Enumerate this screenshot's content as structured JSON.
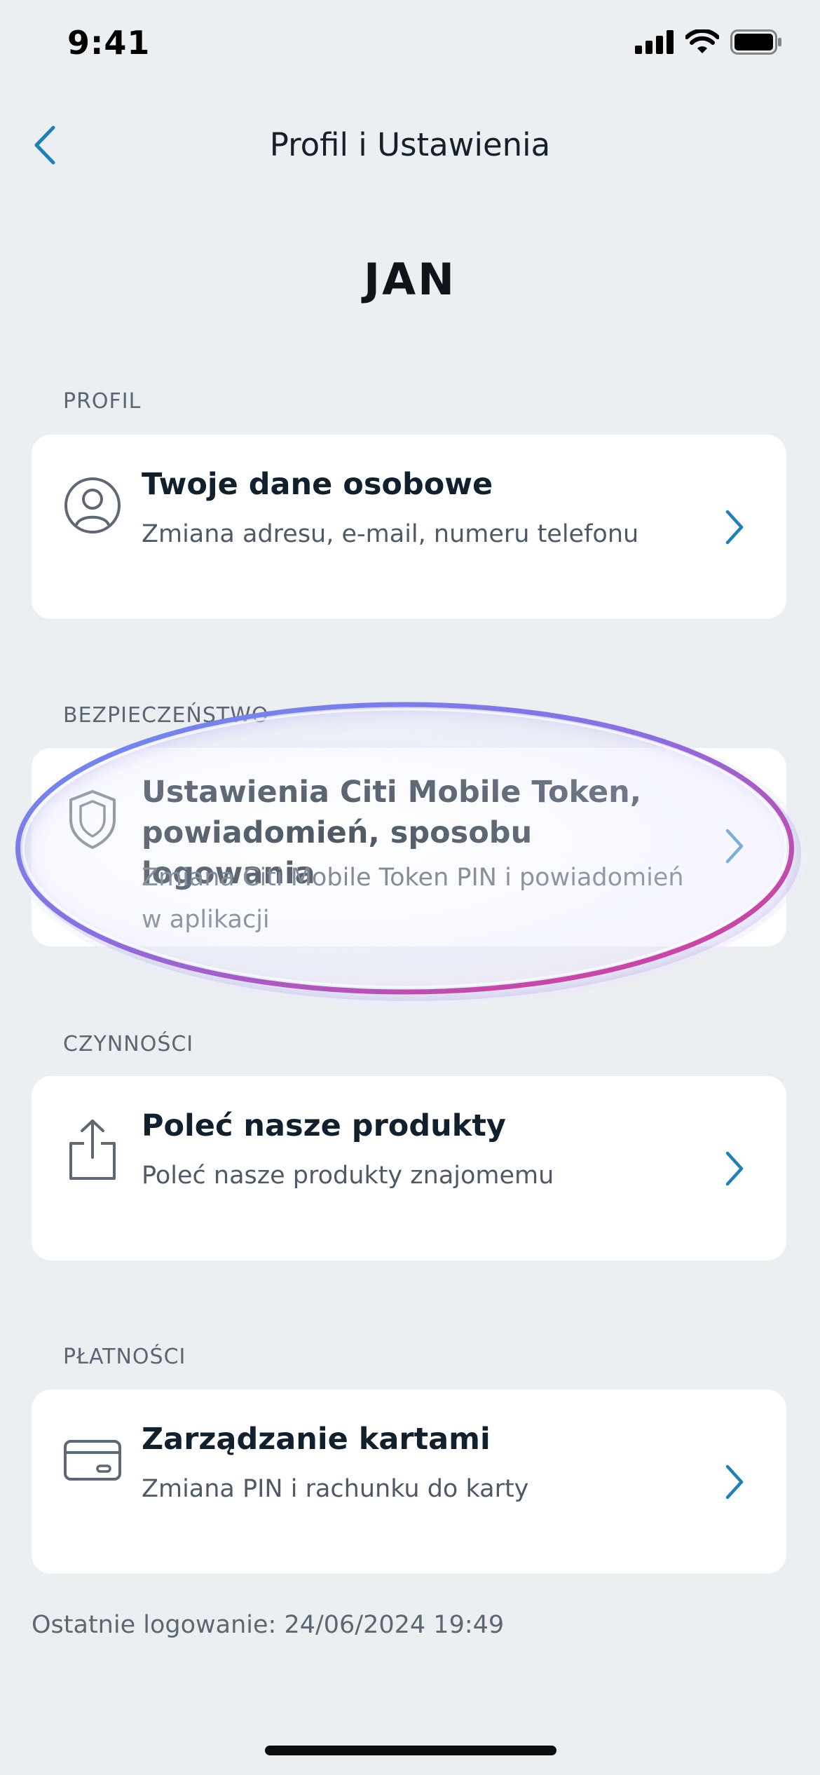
{
  "status_bar": {
    "time": "9:41"
  },
  "nav": {
    "title": "Profil i Ustawienia"
  },
  "user": {
    "name": "JAN"
  },
  "sections": {
    "profil": {
      "label": "PROFIL",
      "card": {
        "title": "Twoje dane osobowe",
        "subtitle": "Zmiana adresu, e-mail, numeru telefonu",
        "icon": "user-circle-icon"
      }
    },
    "bezpieczenstwo": {
      "label": "BEZPIECZEŃSTWO",
      "card": {
        "title_line1": "Ustawienia Citi Mobile Token,",
        "title_line2": "powiadomień, sposobu logowania",
        "subtitle_line1": "Zmiana Citi Mobile Token PIN i powiadomień",
        "subtitle_line2": "w aplikacji",
        "icon": "shield-icon"
      }
    },
    "czynnosci": {
      "label": "CZYNNOŚCI",
      "card": {
        "title": "Poleć nasze produkty",
        "subtitle": "Poleć nasze produkty znajomemu",
        "icon": "share-icon"
      }
    },
    "platnosci": {
      "label": "PŁATNOŚCI",
      "card": {
        "title": "Zarządzanie kartami",
        "subtitle": "Zmiana PIN i rachunku do karty",
        "icon": "credit-card-icon"
      }
    }
  },
  "footer": {
    "last_login": "Ostatnie logowanie: 24/06/2024 19:49"
  },
  "colors": {
    "accent": "#1f7fb8",
    "background": "#eceff2",
    "card": "#ffffff"
  }
}
